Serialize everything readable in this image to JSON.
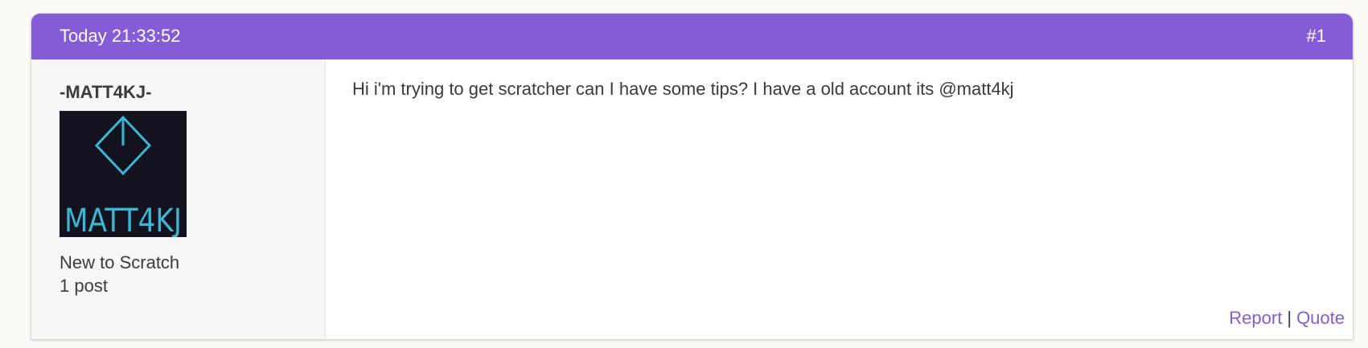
{
  "post": {
    "timestamp": "Today 21:33:52",
    "number": "#1",
    "author": {
      "username": "-MATT4KJ-",
      "avatar_text": "MATT4KJ",
      "rank": "New to Scratch",
      "post_count": "1 post"
    },
    "body": "Hi i'm trying to get scratcher can I have some tips? I have a old account its @matt4kj",
    "actions": {
      "report_label": "Report",
      "separator": "|",
      "quote_label": "Quote"
    }
  },
  "colors": {
    "header_bg": "#855cd6",
    "link": "#855cd6",
    "avatar_bg": "#13131f",
    "avatar_line": "#3cb6d4"
  }
}
